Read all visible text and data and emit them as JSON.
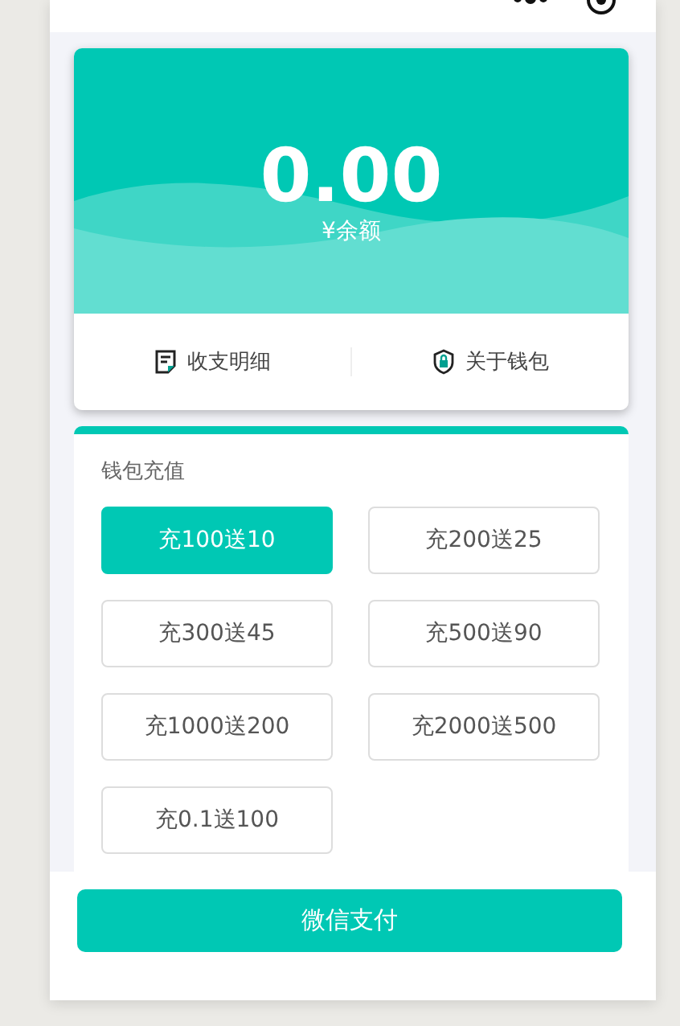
{
  "balance": {
    "amount": "0.00",
    "label": "¥余额"
  },
  "links": [
    {
      "kind": "bill",
      "label": "收支明细"
    },
    {
      "kind": "shield",
      "label": "关于钱包"
    }
  ],
  "recharge": {
    "title": "钱包充值",
    "options": [
      {
        "label": "充100送10",
        "selected": true
      },
      {
        "label": "充200送25",
        "selected": false
      },
      {
        "label": "充300送45",
        "selected": false
      },
      {
        "label": "充500送90",
        "selected": false
      },
      {
        "label": "充1000送200",
        "selected": false
      },
      {
        "label": "充2000送500",
        "selected": false
      },
      {
        "label": "充0.1送100",
        "selected": false
      }
    ]
  },
  "pay_button": "微信支付"
}
